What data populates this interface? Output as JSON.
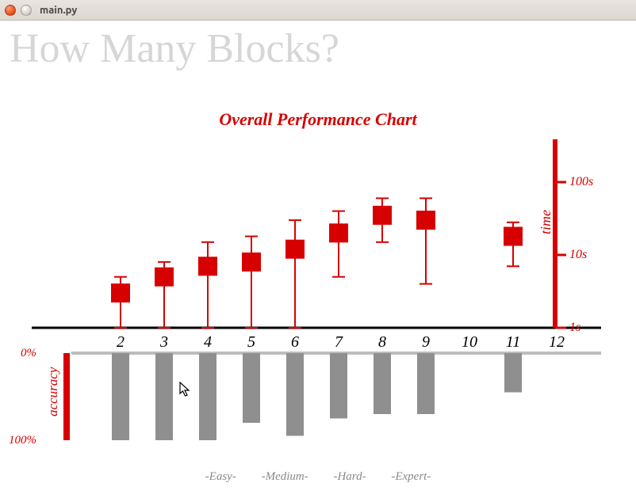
{
  "window": {
    "title": "main.py"
  },
  "heading": "How Many Blocks?",
  "chart_title": "Overall Performance Chart",
  "footer": {
    "easy": "-Easy-",
    "medium": "-Medium-",
    "hard": "-Hard-",
    "expert": "-Expert-"
  },
  "axis": {
    "x_ticks": [
      "2",
      "3",
      "4",
      "5",
      "6",
      "7",
      "8",
      "9",
      "10",
      "11",
      "12"
    ],
    "time_ticks": [
      "1s",
      "10s",
      "100s"
    ],
    "time_label": "time",
    "acc_top": "0%",
    "acc_bottom": "100%",
    "acc_label": "accuracy"
  },
  "chart_data": {
    "type": "bar",
    "title": "Overall Performance Chart",
    "x": [
      2,
      3,
      4,
      5,
      6,
      7,
      8,
      9,
      10,
      11,
      12
    ],
    "xlabel": "",
    "categories": [
      "2",
      "3",
      "4",
      "5",
      "6",
      "7",
      "8",
      "9",
      "10",
      "11",
      "12"
    ],
    "series": [
      {
        "name": "time",
        "axis": "right",
        "scale": "log",
        "unit": "s",
        "ylim": [
          1,
          200
        ],
        "ticks": [
          1,
          10,
          100
        ],
        "tick_labels": [
          "1s",
          "10s",
          "100s"
        ],
        "values": [
          3,
          5,
          7,
          8,
          12,
          20,
          35,
          30,
          null,
          18,
          null
        ],
        "error_low": [
          1,
          1,
          1,
          1,
          1,
          5,
          15,
          4,
          null,
          7,
          null
        ],
        "error_high": [
          5,
          8,
          15,
          18,
          30,
          40,
          60,
          60,
          null,
          28,
          null
        ]
      },
      {
        "name": "accuracy",
        "axis": "left",
        "scale": "linear",
        "unit": "%",
        "ylim": [
          0,
          100
        ],
        "ticks": [
          0,
          100
        ],
        "tick_labels": [
          "0%",
          "100%"
        ],
        "values": [
          100,
          100,
          100,
          80,
          95,
          75,
          70,
          70,
          0,
          45,
          0
        ]
      }
    ],
    "categories_grouping": {
      "Easy": [
        2,
        3,
        4
      ],
      "Medium": [
        5,
        6,
        7
      ],
      "Hard": [
        8,
        9,
        10
      ],
      "Expert": [
        11,
        12
      ]
    }
  },
  "colors": {
    "red": "#d70000",
    "gray": "#8f8f8f",
    "lightgray": "#bdbdbd"
  }
}
